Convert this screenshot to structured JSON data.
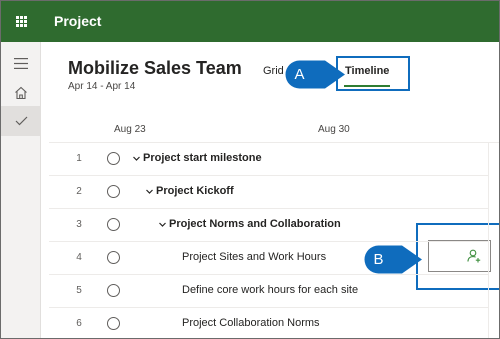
{
  "app": {
    "title": "Project"
  },
  "plan": {
    "title": "Mobilize Sales Team",
    "dates": "Apr 14 - Apr 14"
  },
  "tabs": [
    {
      "label": "Grid"
    },
    {
      "label": "Timeline",
      "selected": true
    }
  ],
  "annotations": {
    "a": "A",
    "b": "B"
  },
  "timeline": {
    "dates": [
      "Aug 23",
      "Aug 30"
    ]
  },
  "rows": [
    {
      "num": "1",
      "title": "Project start milestone",
      "level": 0,
      "summary": true
    },
    {
      "num": "2",
      "title": "Project Kickoff",
      "level": 1,
      "summary": true
    },
    {
      "num": "3",
      "title": "Project Norms and Collaboration",
      "level": 2,
      "summary": true
    },
    {
      "num": "4",
      "title": "Project Sites and Work Hours",
      "level": 3,
      "summary": false
    },
    {
      "num": "5",
      "title": "Define core work hours for each site",
      "level": 3,
      "summary": false
    },
    {
      "num": "6",
      "title": "Project Collaboration Norms",
      "level": 3,
      "summary": false
    }
  ],
  "colors": {
    "top_bar": "#2f6b2f",
    "accent_green": "#2f7d32",
    "callout_blue": "#0f6cbd"
  },
  "icons": {
    "app_launcher": "waffle-icon",
    "menu": "hamburger-icon",
    "home": "home-icon",
    "tasks": "check-icon",
    "assign": "person-add-icon",
    "expand": "chevron-down-icon",
    "task_status": "circle-icon"
  }
}
